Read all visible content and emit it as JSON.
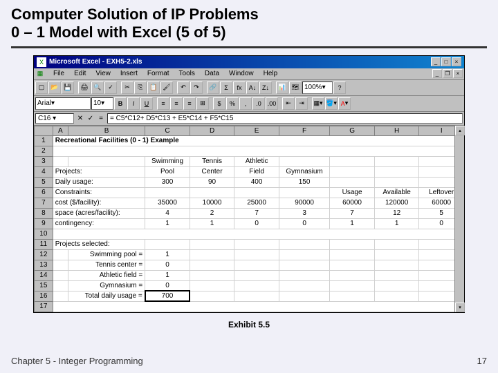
{
  "slide": {
    "title_line1": "Computer Solution of IP Problems",
    "title_line2": "0 – 1 Model with Excel (5 of 5)",
    "exhibit": "Exhibit 5.5",
    "chapter": "Chapter 5 - Integer Programming",
    "page": "17"
  },
  "excel": {
    "title": "Microsoft Excel - EXH5-2.xls",
    "menus": [
      "File",
      "Edit",
      "View",
      "Insert",
      "Format",
      "Tools",
      "Data",
      "Window",
      "Help"
    ],
    "font_name": "Arial",
    "font_size": "10",
    "zoom": "100%",
    "namebox": "C16",
    "formula": "= C5*C12+ D5*C13 + E5*C14 + F5*C15",
    "columns": [
      "A",
      "B",
      "C",
      "D",
      "E",
      "F",
      "G",
      "H",
      "I"
    ],
    "rows": {
      "1": {
        "A": "Recreational Facilities (0 - 1) Example"
      },
      "3": {
        "B": "",
        "C": "Swimming",
        "D": "Tennis",
        "E": "Athletic"
      },
      "4": {
        "A": "Projects:",
        "C": "Pool",
        "D": "Center",
        "E": "Field",
        "F": "Gymnasium"
      },
      "5": {
        "A": "Daily usage:",
        "C": "300",
        "D": "90",
        "E": "400",
        "F": "150"
      },
      "6": {
        "A": "Constraints:",
        "G": "Usage",
        "H": "Available",
        "I": "Leftover"
      },
      "7": {
        "A": "cost ($/facility):",
        "C": "35000",
        "D": "10000",
        "E": "25000",
        "F": "90000",
        "G": "60000",
        "H": "120000",
        "I": "60000"
      },
      "8": {
        "A": "space (acres/facility):",
        "C": "4",
        "D": "2",
        "E": "7",
        "F": "3",
        "G": "7",
        "H": "12",
        "I": "5"
      },
      "9": {
        "A": "contingency:",
        "C": "1",
        "D": "1",
        "E": "0",
        "F": "0",
        "G": "1",
        "H": "1",
        "I": "0"
      },
      "11": {
        "A": "Projects selected:"
      },
      "12": {
        "B": "Swimming pool =",
        "C": "1"
      },
      "13": {
        "B": "Tennis center =",
        "C": "0"
      },
      "14": {
        "B": "Athletic field =",
        "C": "1"
      },
      "15": {
        "B": "Gymnasium =",
        "C": "0"
      },
      "16": {
        "B": "Total daily usage =",
        "C": "700"
      }
    }
  }
}
